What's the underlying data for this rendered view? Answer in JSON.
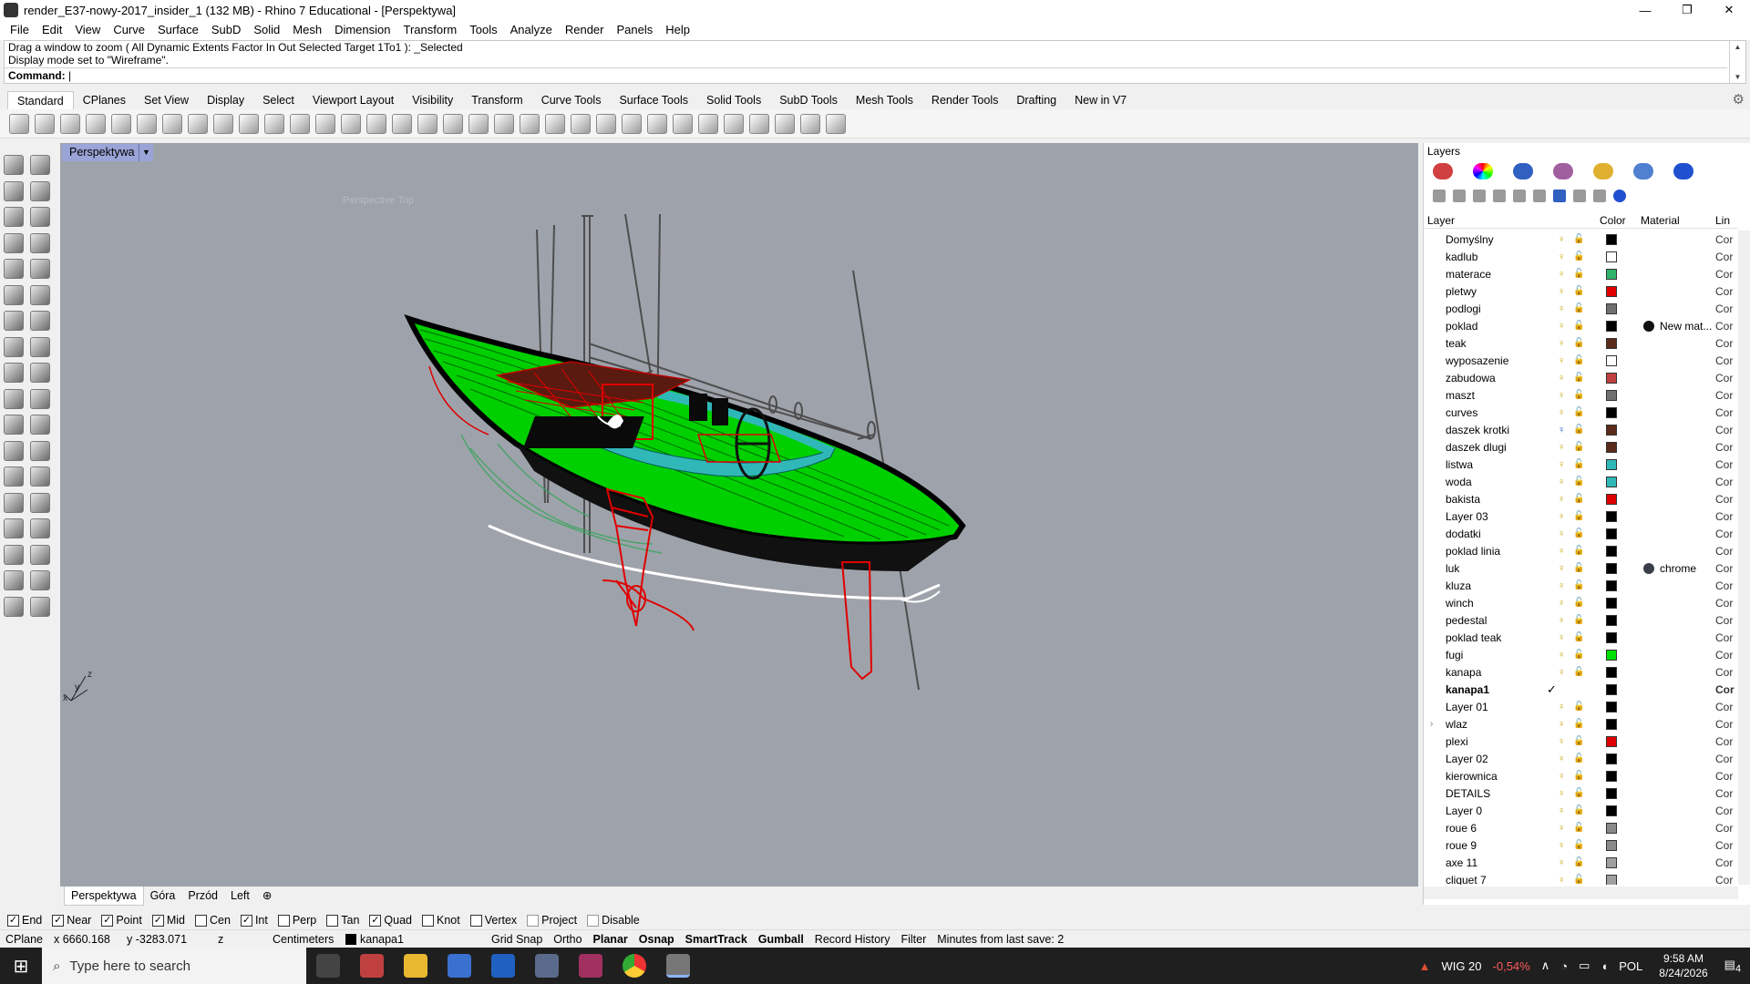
{
  "window": {
    "title": "render_E37-nowy-2017_insider_1 (132 MB) - Rhino 7 Educational - [Perspektywa]",
    "minimize": "—",
    "maximize": "❐",
    "close": "✕"
  },
  "menu": [
    "File",
    "Edit",
    "View",
    "Curve",
    "Surface",
    "SubD",
    "Solid",
    "Mesh",
    "Dimension",
    "Transform",
    "Tools",
    "Analyze",
    "Render",
    "Panels",
    "Help"
  ],
  "command": {
    "history": [
      "Drag a window to zoom ( All  Dynamic  Extents  Factor  In  Out  Selected  Target  1To1 ): _Selected",
      "Display mode set to \"Wireframe\"."
    ],
    "prompt": "Command:"
  },
  "toolbar_tabs": [
    "Standard",
    "CPlanes",
    "Set View",
    "Display",
    "Select",
    "Viewport Layout",
    "Visibility",
    "Transform",
    "Curve Tools",
    "Surface Tools",
    "Solid Tools",
    "SubD Tools",
    "Mesh Tools",
    "Render Tools",
    "Drafting",
    "New in V7"
  ],
  "toolbar_tabs_active": "Standard",
  "viewport": {
    "label": "Perspektywa",
    "ghost_text": "Perspective Top",
    "axis_z": "z",
    "axis_y": "y",
    "axis_x": "x"
  },
  "view_tabs": [
    "Perspektywa",
    "Góra",
    "Przód",
    "Left"
  ],
  "view_tabs_active": "Perspektywa",
  "view_tabs_add": "⊕",
  "layers_panel": {
    "title": "Layers",
    "columns": {
      "layer": "Layer",
      "color": "Color",
      "material": "Material",
      "linetype": "Lin"
    },
    "rows": [
      {
        "name": "Domyślny",
        "color": "#000000",
        "lt": "Cor"
      },
      {
        "name": "kadlub",
        "color": "#ffffff",
        "lt": "Cor"
      },
      {
        "name": "materace",
        "color": "#2fb36a",
        "lt": "Cor"
      },
      {
        "name": "pletwy",
        "color": "#e00000",
        "lt": "Cor"
      },
      {
        "name": "podlogi",
        "color": "#707070",
        "lt": "Cor"
      },
      {
        "name": "poklad",
        "color": "#000000",
        "material": "New mat...",
        "lt": "Cor"
      },
      {
        "name": "teak",
        "color": "#5a2a1a",
        "lt": "Cor"
      },
      {
        "name": "wyposazenie",
        "color": "#ffffff",
        "lt": "Cor"
      },
      {
        "name": "zabudowa",
        "color": "#c04040",
        "lt": "Cor"
      },
      {
        "name": "maszt",
        "color": "#707070",
        "lt": "Cor"
      },
      {
        "name": "curves",
        "color": "#000000",
        "lt": "Cor"
      },
      {
        "name": "daszek krotki",
        "color": "#5a2a1a",
        "lt": "Cor"
      },
      {
        "name": "daszek dlugi",
        "color": "#5a2a1a",
        "lt": "Cor"
      },
      {
        "name": "listwa",
        "color": "#30b8b8",
        "lt": "Cor"
      },
      {
        "name": "woda",
        "color": "#30b8b8",
        "lt": "Cor"
      },
      {
        "name": "bakista",
        "color": "#e00000",
        "lt": "Cor"
      },
      {
        "name": "Layer 03",
        "color": "#000000",
        "lt": "Cor"
      },
      {
        "name": "dodatki",
        "color": "#000000",
        "lt": "Cor"
      },
      {
        "name": "poklad linia",
        "color": "#000000",
        "lt": "Cor"
      },
      {
        "name": "luk",
        "color": "#000000",
        "material": "chrome",
        "lt": "Cor"
      },
      {
        "name": "kluza",
        "color": "#000000",
        "lt": "Cor"
      },
      {
        "name": "winch",
        "color": "#000000",
        "lt": "Cor"
      },
      {
        "name": "pedestal",
        "color": "#000000",
        "lt": "Cor"
      },
      {
        "name": "poklad teak",
        "color": "#000000",
        "lt": "Cor"
      },
      {
        "name": "fugi",
        "color": "#00e000",
        "lt": "Cor"
      },
      {
        "name": "kanapa",
        "color": "#000000",
        "lt": "Cor"
      },
      {
        "name": "kanapa1",
        "color": "#000000",
        "lt": "Cor",
        "current": true
      },
      {
        "name": "Layer 01",
        "color": "#000000",
        "lt": "Cor"
      },
      {
        "name": "wlaz",
        "color": "#000000",
        "lt": "Cor",
        "expand": "›"
      },
      {
        "name": "plexi",
        "color": "#e00000",
        "lt": "Cor"
      },
      {
        "name": "Layer 02",
        "color": "#000000",
        "lt": "Cor"
      },
      {
        "name": "kierownica",
        "color": "#000000",
        "lt": "Cor"
      },
      {
        "name": "DETAILS",
        "color": "#000000",
        "lt": "Cor"
      },
      {
        "name": "Layer 0",
        "color": "#000000",
        "lt": "Cor"
      },
      {
        "name": "roue 6",
        "color": "#8a8a8a",
        "lt": "Cor"
      },
      {
        "name": "roue 9",
        "color": "#8a8a8a",
        "lt": "Cor"
      },
      {
        "name": "axe 11",
        "color": "#a0a0a0",
        "lt": "Cor"
      },
      {
        "name": "cliquet 7",
        "color": "#a0a0a0",
        "lt": "Cor"
      }
    ]
  },
  "osnap": [
    {
      "label": "End",
      "checked": true
    },
    {
      "label": "Near",
      "checked": true
    },
    {
      "label": "Point",
      "checked": true
    },
    {
      "label": "Mid",
      "checked": true
    },
    {
      "label": "Cen",
      "checked": false
    },
    {
      "label": "Int",
      "checked": true
    },
    {
      "label": "Perp",
      "checked": false
    },
    {
      "label": "Tan",
      "checked": false
    },
    {
      "label": "Quad",
      "checked": true
    },
    {
      "label": "Knot",
      "checked": false
    },
    {
      "label": "Vertex",
      "checked": false
    },
    {
      "label": "Project",
      "checked": false,
      "dim": true
    },
    {
      "label": "Disable",
      "checked": false,
      "dim": true
    }
  ],
  "status": {
    "cplane": "CPlane",
    "x": "x 6660.168",
    "y": "y -3283.071",
    "z": "z",
    "units": "Centimeters",
    "layer": "kanapa1",
    "grid_snap": "Grid Snap",
    "ortho": "Ortho",
    "planar": "Planar",
    "osnap": "Osnap",
    "smarttrack": "SmartTrack",
    "gumball": "Gumball",
    "record_history": "Record History",
    "filter": "Filter",
    "last_save": "Minutes from last save: 2"
  },
  "taskbar": {
    "search_placeholder": "Type here to search",
    "stock_name": "WIG 20",
    "stock_change": "-0,54%",
    "language": "POL",
    "time": "9:58 AM",
    "date": "8/24/2026",
    "notifications": "4",
    "up_arrow": "∧"
  },
  "colors": {
    "viewport_bg": "#9ea3ab",
    "viewport_label_bg": "#9aa4d6",
    "hull_green": "#00d800",
    "rudder_red": "#e00000",
    "accent_cyan": "#30b8b8",
    "taskbar_bg": "#1f1f1f",
    "stock_negative": "#ff5a5a"
  }
}
